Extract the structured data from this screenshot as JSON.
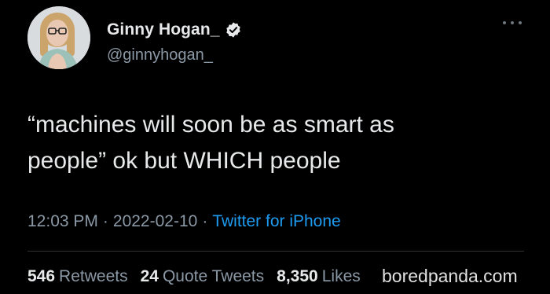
{
  "author": {
    "display_name": "Ginny Hogan_",
    "handle": "@ginnyhogan_",
    "verified_icon": "verified-badge-icon",
    "avatar_icon": "profile-avatar"
  },
  "menu": {
    "more_icon": "more-options-icon"
  },
  "tweet": {
    "text": "“machines will soon be as smart as\npeople” ok but WHICH people"
  },
  "meta": {
    "time": "12:03 PM",
    "separator": "·",
    "date": "2022-02-10",
    "source": "Twitter for iPhone"
  },
  "stats": {
    "retweets_count": "546",
    "retweets_label": "Retweets",
    "quotes_count": "24",
    "quotes_label": "Quote Tweets",
    "likes_count": "8,350",
    "likes_label": "Likes"
  },
  "watermark": "boredpanda.com",
  "colors": {
    "background": "#000000",
    "primary_text": "#e7e9ea",
    "secondary_text": "#8b98a5",
    "link": "#1d9bf0",
    "verified": "#e7e9ea"
  }
}
